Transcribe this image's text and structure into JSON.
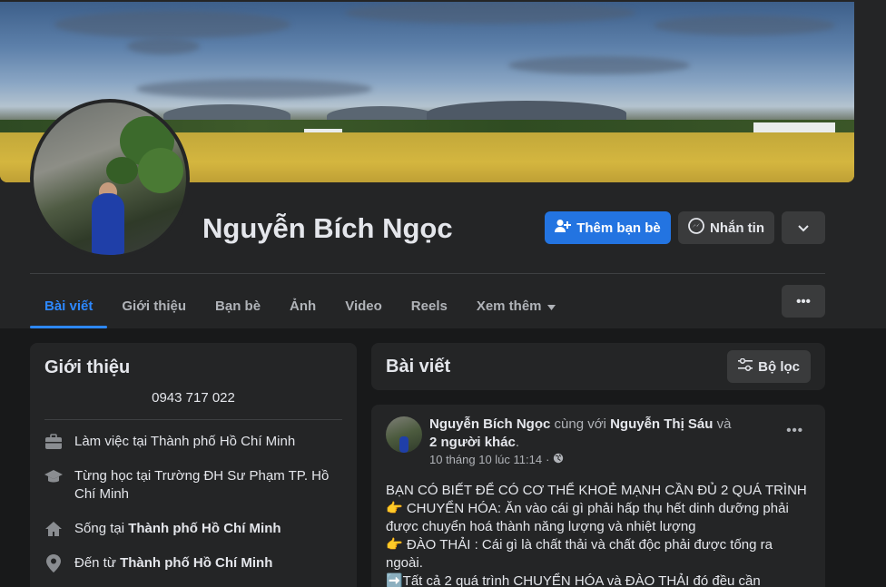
{
  "profile": {
    "name": "Nguyễn Bích Ngọc",
    "add_friend_label": "Thêm bạn bè",
    "message_label": "Nhắn tin"
  },
  "tabs": [
    {
      "label": "Bài viết",
      "active": true
    },
    {
      "label": "Giới thiệu",
      "active": false
    },
    {
      "label": "Bạn bè",
      "active": false
    },
    {
      "label": "Ảnh",
      "active": false
    },
    {
      "label": "Video",
      "active": false
    },
    {
      "label": "Reels",
      "active": false
    },
    {
      "label": "Xem thêm",
      "active": false
    }
  ],
  "intro": {
    "title": "Giới thiệu",
    "phone": "0943 717 022",
    "work": "Làm việc tại Thành phố Hồ Chí Minh",
    "study": "Từng học tại Trường ĐH Sư Phạm TP. Hồ Chí Minh",
    "lives_prefix": "Sống tại",
    "lives_place": "Thành phố Hồ Chí Minh",
    "from_prefix": "Đến từ",
    "from_place": "Thành phố Hồ Chí Minh"
  },
  "posts_header": {
    "title": "Bài viết",
    "filter_label": "Bộ lọc"
  },
  "post": {
    "author": "Nguyễn Bích Ngọc",
    "with_text": "cùng với",
    "tagged": "Nguyễn Thị Sáu",
    "and_text": "và",
    "others": "2 người khác",
    "time": "10 tháng 10 lúc 11:14",
    "line1": "BẠN CÓ BIẾT ĐỂ CÓ CƠ THỂ KHOẺ MẠNH CẦN ĐỦ 2 QUÁ TRÌNH",
    "line2": "👉 CHUYỂN HÓA: Ăn vào cái gì phải hấp thụ hết dinh dưỡng phải được chuyển hoá thành năng lượng và nhiệt lượng",
    "line3": "👉 ĐÀO THẢI : Cái gì là chất thải và chất độc phải được tống ra ngoài.",
    "line4": "➡️Tất cả 2 quá trình  CHUYỂN HÓA và ĐÀO THẢI đó đều cần"
  },
  "colors": {
    "accent": "#2374e1",
    "tab_active": "#2d88ff",
    "card_bg": "#242526",
    "page_bg": "#18191a"
  }
}
